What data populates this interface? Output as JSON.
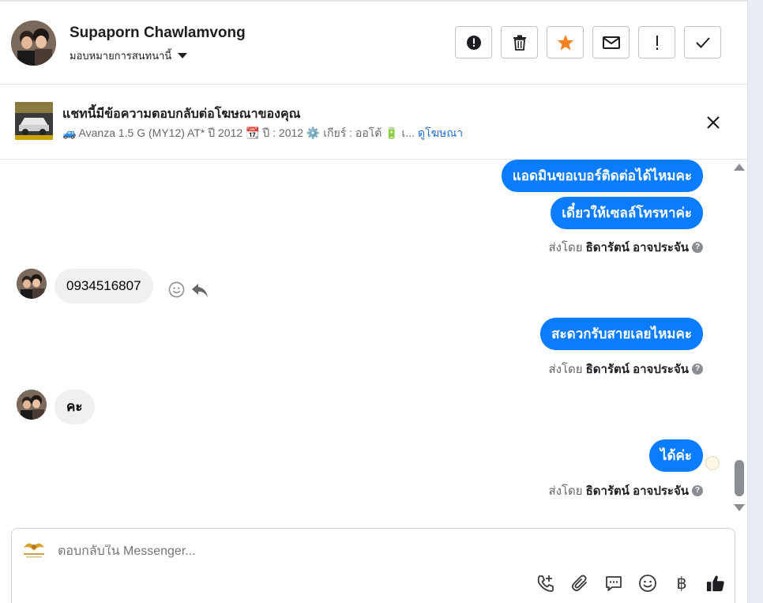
{
  "header": {
    "contact_name": "Supaporn Chawlamvong",
    "assign_label": "มอบหมายการสนทนานี้",
    "actions": [
      {
        "icon": "alert-circle-icon",
        "label": "Report"
      },
      {
        "icon": "trash-icon",
        "label": "Delete"
      },
      {
        "icon": "star-icon",
        "label": "Star"
      },
      {
        "icon": "envelope-icon",
        "label": "Mark unread"
      },
      {
        "icon": "exclamation-icon",
        "label": "Spam"
      },
      {
        "icon": "check-icon",
        "label": "Done"
      }
    ]
  },
  "ad_banner": {
    "title": "แชทนี้มีข้อความตอบกลับต่อโฆษณาของคุณ",
    "subtitle": "🚙 Avanza 1.5 G (MY12) AT* ปี 2012 📆 ปี : 2012 ⚙️ เกียร์ : ออโต้ 🔋 เ...",
    "link": "ดูโฆษณา"
  },
  "thread": {
    "messages": [
      {
        "direction": "out",
        "text": "แอดมินขอเบอร์ติดต่อได้ไหมคะ"
      },
      {
        "direction": "out",
        "text": "เดี๋ยวให้เซลล์โทรหาค่ะ"
      },
      {
        "direction": "out",
        "text": "สะดวกรับสายเลยไหมคะ"
      },
      {
        "direction": "out",
        "text": "ได้ค่ะ"
      },
      {
        "direction": "in",
        "text": "0934516807"
      },
      {
        "direction": "in",
        "text": "คะ"
      }
    ],
    "sent_by_prefix": "ส่งโดย",
    "sent_by_name": "ธิดารัตน์ อาจประจัน",
    "help_glyph": "?"
  },
  "composer": {
    "placeholder": "ตอบกลับใน Messenger...",
    "tools": [
      "call-add-icon",
      "paperclip-icon",
      "chat-bubble-icon",
      "emoji-icon",
      "baht-icon",
      "thumbs-up-icon"
    ],
    "baht_glyph": "฿"
  },
  "colors": {
    "outgoing_bubble": "#0a7cff",
    "incoming_bubble": "#f0f0f0",
    "link": "#216fdb",
    "star": "#f5821f"
  }
}
